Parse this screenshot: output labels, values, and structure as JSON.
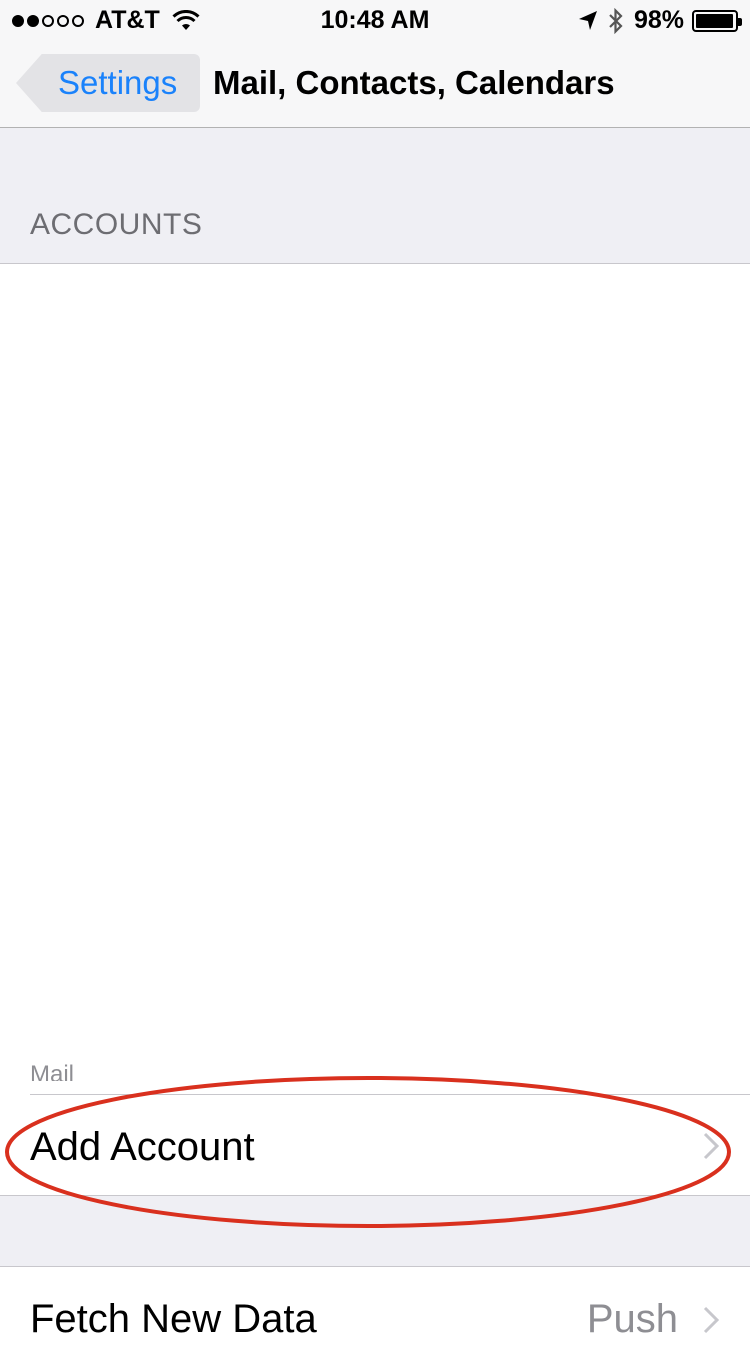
{
  "status_bar": {
    "carrier": "AT&T",
    "time": "10:48 AM",
    "battery": "98%",
    "battery_level": 0.98
  },
  "nav": {
    "back_label": "Settings",
    "title": "Mail, Contacts, Calendars"
  },
  "accounts": {
    "header": "ACCOUNTS",
    "mail_label": "Mail",
    "add_account_label": "Add Account"
  },
  "fetch": {
    "label": "Fetch New Data",
    "value": "Push"
  },
  "colors": {
    "accent": "#1a82fb",
    "annotation": "#d9301e"
  }
}
